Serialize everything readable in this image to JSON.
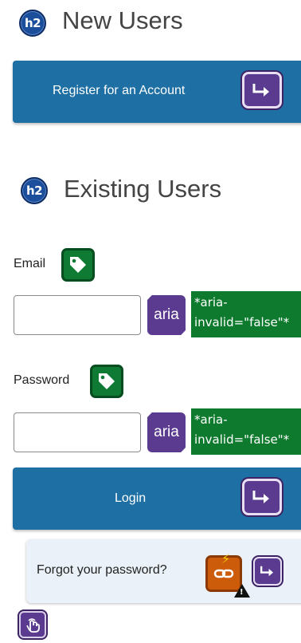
{
  "new_users": {
    "badge": "h2",
    "title": "New Users",
    "register_label": "Register for an Account"
  },
  "existing_users": {
    "badge": "h2",
    "title": "Existing Users",
    "email_label": "Email",
    "email_value": "",
    "email_aria_badge": "aria",
    "email_aria_note_line1": "*aria-",
    "email_aria_note_line2": "invalid=\"false\"*",
    "password_label": "Password",
    "password_value": "",
    "password_aria_badge": "aria",
    "password_aria_note_line1": "*aria-",
    "password_aria_note_line2": "invalid=\"false\"*",
    "login_label": "Login",
    "forgot_label": "Forgot your password?"
  },
  "colors": {
    "button_blue": "#1e6fa3",
    "role_purple": "#5a3b8f",
    "label_green": "#0e7a34",
    "link_orange": "#cc5c0a",
    "panel_bg": "#eaf1f8"
  },
  "icons": {
    "heading_badge": "h2-icon",
    "button_role": "button-role-icon",
    "label_tag": "label-tag-icon",
    "broken_link": "broken-link-icon",
    "warning": "warning-icon",
    "touch": "touch-icon"
  }
}
